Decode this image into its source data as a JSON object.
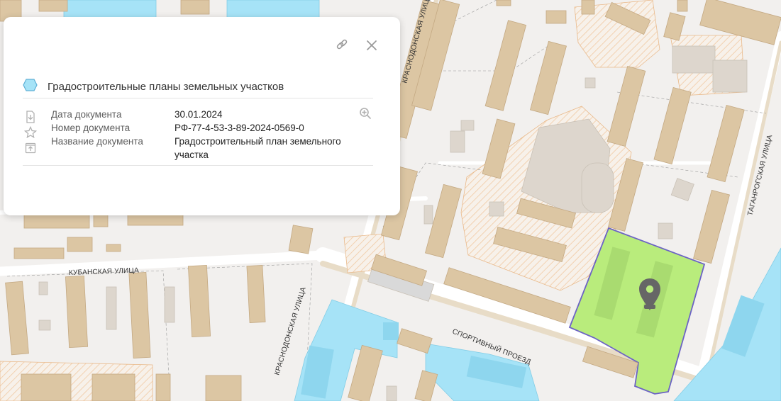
{
  "map": {
    "streets": [
      {
        "id": "krasnodonskaya-north",
        "name": "КРАСНОДОНСКАЯ УЛИЦА"
      },
      {
        "id": "krasnodonskaya-south",
        "name": "КРАСНОДОНСКАЯ УЛИЦА"
      },
      {
        "id": "kubanskaya",
        "name": "КУБАНСКАЯ УЛИЦА"
      },
      {
        "id": "taganrogskaya",
        "name": "ТАГАНРОГСКАЯ УЛИЦА"
      },
      {
        "id": "sportivny",
        "name": "СПОРТИВНЫЙ ПРОЕЗД"
      }
    ],
    "colors": {
      "background": "#f2f0ee",
      "building": "#dcc6a3",
      "building_stroke": "#c4a983",
      "water": "#a6e3f7",
      "selected_parcel": "#b9ec7c",
      "selected_parcel_border": "#6c63c4",
      "marker": "#666666"
    }
  },
  "card": {
    "title": "Градостроительные планы земельных участков",
    "fields": [
      {
        "label": "Дата документа",
        "value": "30.01.2024"
      },
      {
        "label": "Номер документа",
        "value": "РФ-77-4-53-3-89-2024-0569-0"
      },
      {
        "label": "Название документа",
        "value": "Градостроительный план земельного участка"
      }
    ],
    "icons": {
      "title": "parcel-pentagon-icon",
      "link": "link-icon",
      "close": "close-icon",
      "zoom": "zoom-in-icon",
      "download": "download-icon",
      "favorite": "star-icon",
      "open": "open-external-icon"
    }
  }
}
